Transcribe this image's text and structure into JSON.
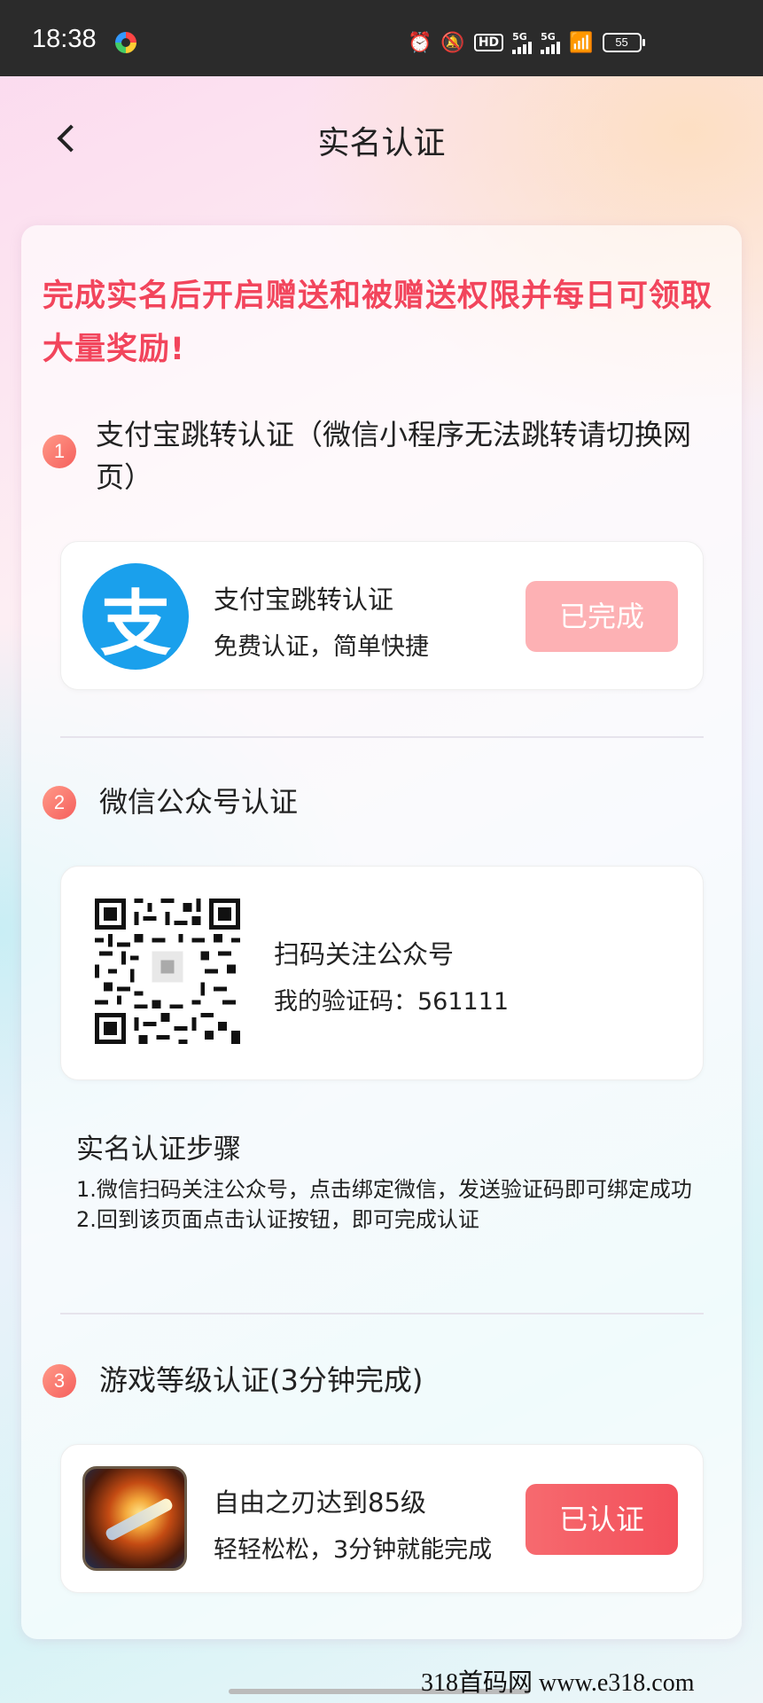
{
  "status_bar": {
    "time": "18:38",
    "hd_label": "HD",
    "net1": "5G",
    "net2": "5G",
    "battery": "55"
  },
  "nav": {
    "title": "实名认证"
  },
  "banner": "完成实名后开启赠送和被赠送权限并每日可领取大量奖励!",
  "step1": {
    "num": "1",
    "title": "支付宝跳转认证（微信小程序无法跳转请切换网页）",
    "item_title": "支付宝跳转认证",
    "item_sub": "免费认证，简单快捷",
    "logo_char": "支",
    "button": "已完成"
  },
  "step2": {
    "num": "2",
    "title": "微信公众号认证",
    "qr_title": "扫码关注公众号",
    "code_text": "我的验证码：561111",
    "steps_title": "实名认证步骤",
    "steps_line1": "1.微信扫码关注公众号，点击绑定微信，发送验证码即可绑定成功",
    "steps_line2": "2.回到该页面点击认证按钮，即可完成认证"
  },
  "step3": {
    "num": "3",
    "title": "游戏等级认证(3分钟完成)",
    "item_title": "自由之刃达到85级",
    "item_sub": "轻轻松松，3分钟就能完成",
    "button": "已认证"
  },
  "watermark": "318首码网  www.e318.com"
}
